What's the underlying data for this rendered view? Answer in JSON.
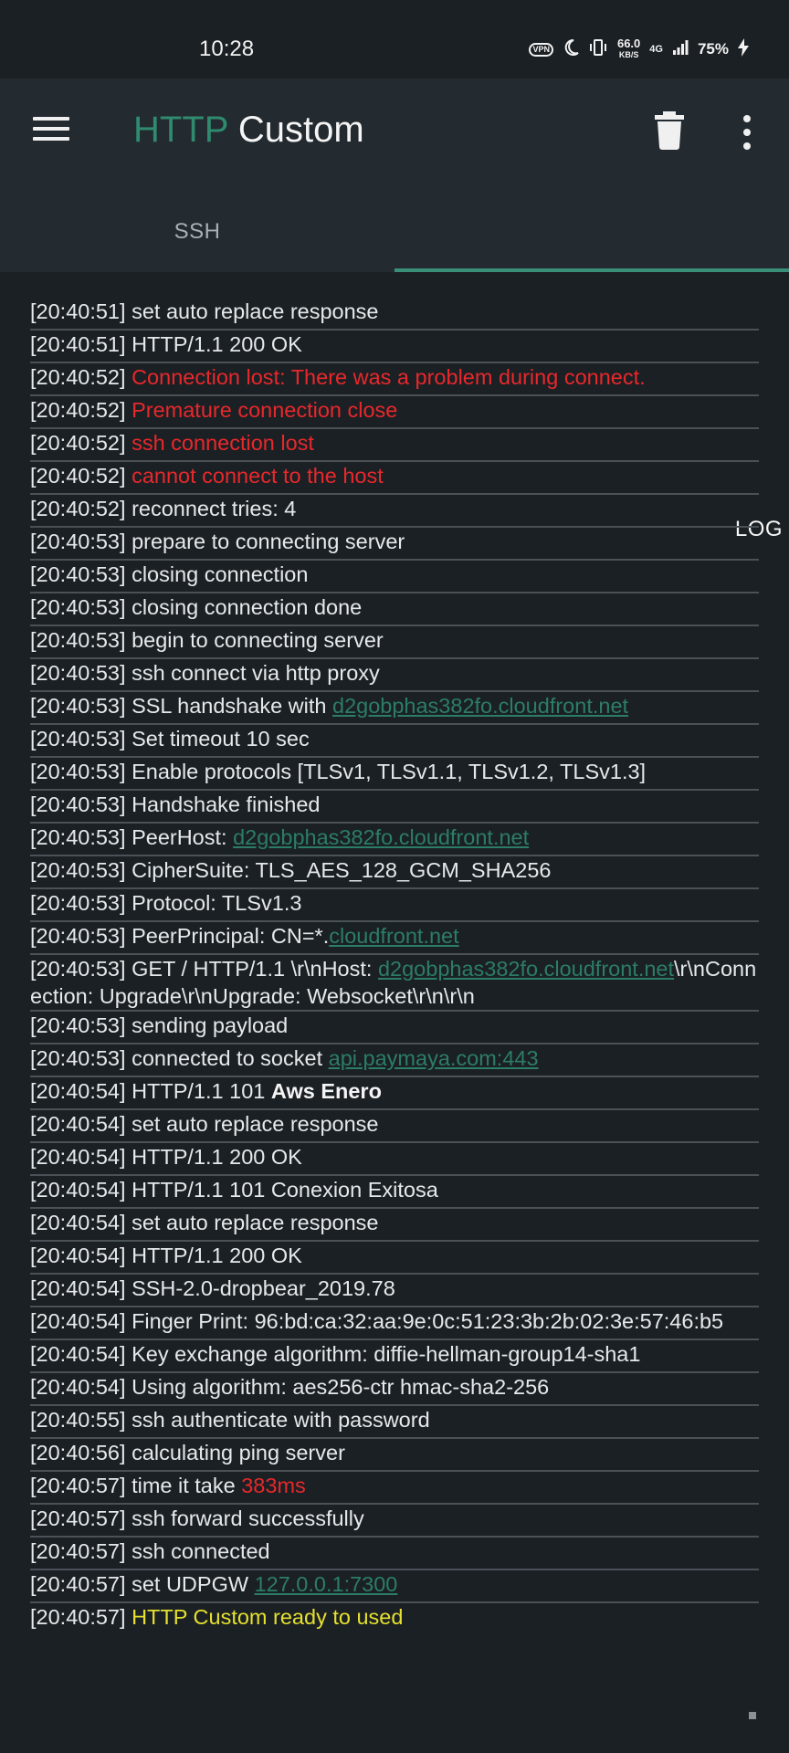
{
  "status_bar": {
    "time": "10:28",
    "vpn": "VPN",
    "speed_value": "66.0",
    "speed_unit": "KB/S",
    "network": "4G",
    "battery": "75%"
  },
  "app": {
    "title_part1": "HTTP",
    "title_part2": " Custom",
    "menu_icon": "hamburger-icon",
    "trash_icon": "trash-icon",
    "more_icon": "more-vertical-icon"
  },
  "tabs": [
    {
      "label": "SSH",
      "selected": false
    },
    {
      "label": "LOG",
      "selected": true
    }
  ],
  "colors": {
    "background": "#1b2024",
    "appbar": "#232a30",
    "accent": "#2f8a6e",
    "error": "#e8282b",
    "link": "#2c7d68",
    "success": "#e5e02f"
  },
  "log": [
    {
      "ts": "[20:40:51]",
      "segments": [
        {
          "text": " set auto replace response",
          "style": "normal"
        }
      ]
    },
    {
      "ts": "[20:40:51]",
      "segments": [
        {
          "text": " HTTP/1.1 200 OK",
          "style": "normal"
        }
      ]
    },
    {
      "ts": "[20:40:52]",
      "segments": [
        {
          "text": " ",
          "style": "normal"
        },
        {
          "text": "Connection lost: There was a problem during connect.",
          "style": "red"
        }
      ]
    },
    {
      "ts": "[20:40:52]",
      "segments": [
        {
          "text": " ",
          "style": "normal"
        },
        {
          "text": "Premature connection close",
          "style": "red"
        }
      ]
    },
    {
      "ts": "[20:40:52]",
      "segments": [
        {
          "text": " ",
          "style": "normal"
        },
        {
          "text": "ssh connection lost",
          "style": "red"
        }
      ]
    },
    {
      "ts": "[20:40:52]",
      "segments": [
        {
          "text": " ",
          "style": "normal"
        },
        {
          "text": "cannot connect to the host",
          "style": "red"
        }
      ]
    },
    {
      "ts": "[20:40:52]",
      "segments": [
        {
          "text": " reconnect tries: 4",
          "style": "normal"
        }
      ]
    },
    {
      "ts": "[20:40:53]",
      "segments": [
        {
          "text": " prepare to connecting server",
          "style": "normal"
        }
      ]
    },
    {
      "ts": "[20:40:53]",
      "segments": [
        {
          "text": " closing connection",
          "style": "normal"
        }
      ]
    },
    {
      "ts": "[20:40:53]",
      "segments": [
        {
          "text": " closing connection done",
          "style": "normal"
        }
      ]
    },
    {
      "ts": "[20:40:53]",
      "segments": [
        {
          "text": " begin to connecting server",
          "style": "normal"
        }
      ]
    },
    {
      "ts": "[20:40:53]",
      "segments": [
        {
          "text": " ssh connect via http proxy",
          "style": "normal"
        }
      ]
    },
    {
      "ts": "[20:40:53]",
      "segments": [
        {
          "text": " SSL handshake with ",
          "style": "normal"
        },
        {
          "text": "d2gobphas382fo.cloudfront.net",
          "style": "link"
        }
      ]
    },
    {
      "ts": "[20:40:53]",
      "segments": [
        {
          "text": " Set timeout 10 sec",
          "style": "normal"
        }
      ]
    },
    {
      "ts": "[20:40:53]",
      "segments": [
        {
          "text": " Enable protocols [TLSv1, TLSv1.1, TLSv1.2, TLSv1.3]",
          "style": "normal"
        }
      ]
    },
    {
      "ts": "[20:40:53]",
      "segments": [
        {
          "text": " Handshake finished",
          "style": "normal"
        }
      ]
    },
    {
      "ts": "[20:40:53]",
      "segments": [
        {
          "text": " PeerHost: ",
          "style": "normal"
        },
        {
          "text": "d2gobphas382fo.cloudfront.net",
          "style": "link"
        }
      ]
    },
    {
      "ts": "[20:40:53]",
      "segments": [
        {
          "text": " CipherSuite: TLS_AES_128_GCM_SHA256",
          "style": "normal"
        }
      ]
    },
    {
      "ts": "[20:40:53]",
      "segments": [
        {
          "text": " Protocol: TLSv1.3",
          "style": "normal"
        }
      ]
    },
    {
      "ts": "[20:40:53]",
      "segments": [
        {
          "text": " PeerPrincipal: CN=*.",
          "style": "normal"
        },
        {
          "text": "cloudfront.net",
          "style": "link"
        }
      ]
    },
    {
      "ts": "[20:40:53]",
      "multi": true,
      "segments": [
        {
          "text": " GET / HTTP/1.1 \\r\\nHost: ",
          "style": "normal"
        },
        {
          "text": "d2gobphas382fo.cloudfront.net",
          "style": "link"
        },
        {
          "text": "\\r\\nConnection: Upgrade\\r\\nUpgrade: Websocket\\r\\n\\r\\n",
          "style": "normal"
        }
      ]
    },
    {
      "ts": "[20:40:53]",
      "segments": [
        {
          "text": " sending payload",
          "style": "normal"
        }
      ]
    },
    {
      "ts": "[20:40:53]",
      "segments": [
        {
          "text": " connected to socket ",
          "style": "normal"
        },
        {
          "text": "api.paymaya.com:443",
          "style": "link"
        }
      ]
    },
    {
      "ts": "[20:40:54]",
      "segments": [
        {
          "text": " HTTP/1.1 101 ",
          "style": "normal"
        },
        {
          "text": "Aws Enero",
          "style": "bold"
        }
      ]
    },
    {
      "ts": "[20:40:54]",
      "segments": [
        {
          "text": " set auto replace response",
          "style": "normal"
        }
      ]
    },
    {
      "ts": "[20:40:54]",
      "segments": [
        {
          "text": " HTTP/1.1 200 OK",
          "style": "normal"
        }
      ]
    },
    {
      "ts": "[20:40:54]",
      "segments": [
        {
          "text": " HTTP/1.1 101 Conexion Exitosa",
          "style": "normal"
        }
      ]
    },
    {
      "ts": "[20:40:54]",
      "segments": [
        {
          "text": " set auto replace response",
          "style": "normal"
        }
      ]
    },
    {
      "ts": "[20:40:54]",
      "segments": [
        {
          "text": " HTTP/1.1 200 OK",
          "style": "normal"
        }
      ]
    },
    {
      "ts": "[20:40:54]",
      "segments": [
        {
          "text": " SSH-2.0-dropbear_2019.78",
          "style": "normal"
        }
      ]
    },
    {
      "ts": "[20:40:54]",
      "multi": true,
      "segments": [
        {
          "text": " Finger Print: 96:bd:ca:32:aa:9e:0c:51:23:3b:2b:02:3e:57:46:b5",
          "style": "normal"
        }
      ]
    },
    {
      "ts": "[20:40:54]",
      "segments": [
        {
          "text": " Key exchange algorithm: diffie-hellman-group14-sha1",
          "style": "normal"
        }
      ]
    },
    {
      "ts": "[20:40:54]",
      "segments": [
        {
          "text": " Using algorithm: aes256-ctr hmac-sha2-256",
          "style": "normal"
        }
      ]
    },
    {
      "ts": "[20:40:55]",
      "segments": [
        {
          "text": " ssh authenticate with password",
          "style": "normal"
        }
      ]
    },
    {
      "ts": "[20:40:56]",
      "segments": [
        {
          "text": " calculating ping server",
          "style": "normal"
        }
      ]
    },
    {
      "ts": "[20:40:57]",
      "segments": [
        {
          "text": " time it take ",
          "style": "normal"
        },
        {
          "text": "383ms",
          "style": "red"
        }
      ]
    },
    {
      "ts": "[20:40:57]",
      "segments": [
        {
          "text": " ssh forward successfully",
          "style": "normal"
        }
      ]
    },
    {
      "ts": "[20:40:57]",
      "segments": [
        {
          "text": " ssh connected",
          "style": "normal"
        }
      ]
    },
    {
      "ts": "[20:40:57]",
      "segments": [
        {
          "text": " set UDPGW ",
          "style": "normal"
        },
        {
          "text": "127.0.0.1:7300",
          "style": "link"
        }
      ]
    },
    {
      "ts": "[20:40:57]",
      "last": true,
      "segments": [
        {
          "text": " ",
          "style": "normal"
        },
        {
          "text": "HTTP Custom ready to used",
          "style": "yellow"
        }
      ]
    }
  ]
}
